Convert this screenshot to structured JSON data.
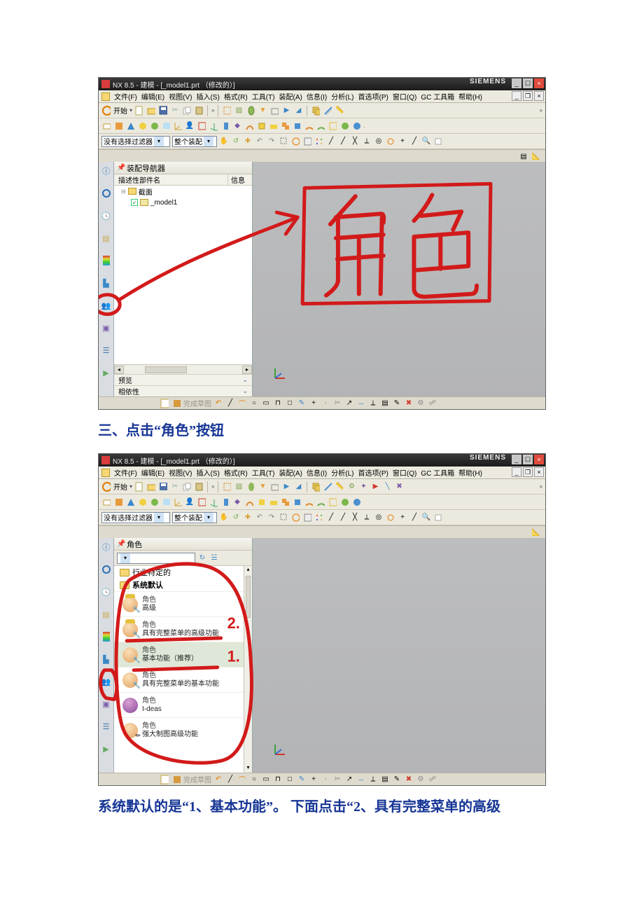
{
  "app": {
    "title": "NX 8.5 - 建模 - [_model1.prt （修改的）]",
    "brand": "SIEMENS"
  },
  "menu": {
    "file": "文件(F)",
    "edit": "编辑(E)",
    "view": "视图(V)",
    "insert": "插入(S)",
    "format": "格式(R)",
    "tools": "工具(T)",
    "assembly": "装配(A)",
    "info": "信息(I)",
    "analysis": "分析(L)",
    "prefs": "首选项(P)",
    "window": "窗口(Q)",
    "gctools": "GC 工具箱",
    "help": "帮助(H)"
  },
  "toolbar1": {
    "start": "开始"
  },
  "filterbar": {
    "no_filter": "没有选择过滤器",
    "scope": "整个装配"
  },
  "nav1": {
    "title": "装配导航器",
    "col_name": "描述性部件名",
    "col_info": "信息",
    "rows": {
      "section": "截面",
      "model": "_model1"
    },
    "preview": "预览",
    "deps": "相依性"
  },
  "bottom": {
    "finish_sketch": "完成草图"
  },
  "captions": {
    "c1": "三、点击“角色”按钮",
    "c2": "系统默认的是“1、基本功能”。 下面点击“2、具有完整菜单的高级"
  },
  "annot": {
    "juese": "角色"
  },
  "roles": {
    "panel_title": "角色",
    "folder_locked": "行业特定的",
    "folder_sys": "系统默认",
    "role_label": "角色",
    "r1": "高级",
    "r2": "具有完整菜单的高级功能",
    "r3": "基本功能（推荐）",
    "r4": "具有完整菜单的基本功能",
    "r5": "I-deas",
    "r6": "强大制图高级功能"
  },
  "annot2": {
    "n1": "1.",
    "n2": "2."
  }
}
